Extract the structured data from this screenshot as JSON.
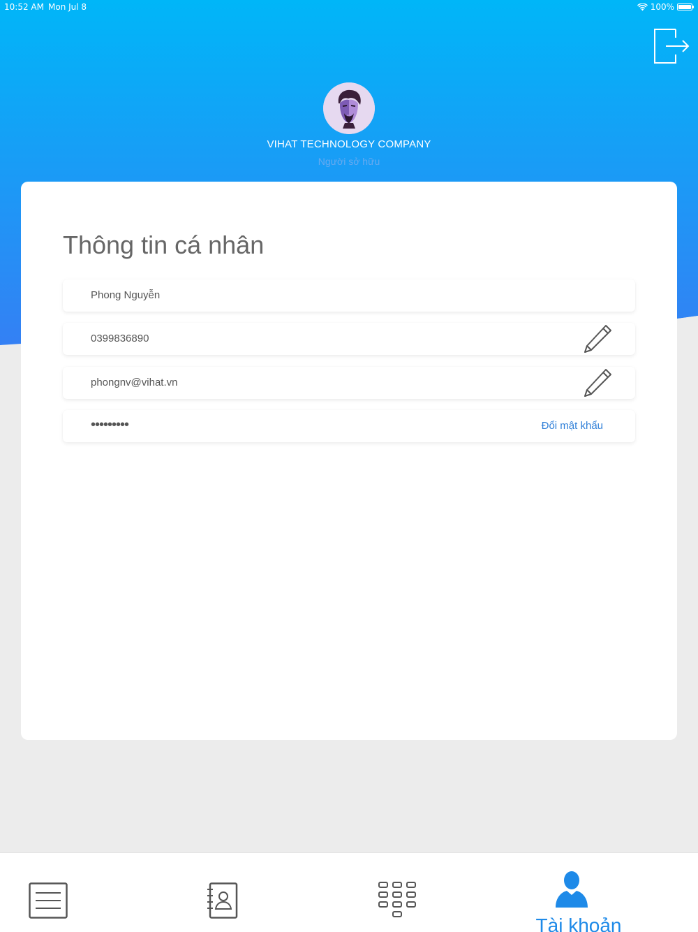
{
  "status_bar": {
    "time": "10:52 AM",
    "date": "Mon Jul 8",
    "battery": "100%",
    "icons": [
      "wifi-icon",
      "battery-icon"
    ]
  },
  "header": {
    "company_name": "VIHAT TECHNOLOGY COMPANY",
    "role": "Người sở hữu",
    "logout_icon": "logout-icon",
    "avatar_icon": "user-avatar"
  },
  "profile": {
    "title": "Thông tin cá nhân",
    "name": "Phong Nguyễn",
    "phone": "0399836890",
    "email": "phongnv@vihat.vn",
    "password_mask": "•••••••••",
    "change_password_label": "Đổi mật khẩu",
    "edit_icon": "pencil-icon"
  },
  "tabbar": {
    "tabs": [
      {
        "icon": "list-icon",
        "label": "",
        "active": false
      },
      {
        "icon": "contacts-book-icon",
        "label": "",
        "active": false
      },
      {
        "icon": "dialpad-icon",
        "label": "",
        "active": false
      },
      {
        "icon": "account-icon",
        "label": "Tài khoản",
        "active": true
      }
    ]
  },
  "colors": {
    "header_gradient_top": "#00b4f8",
    "header_gradient_bottom": "#2f85f5",
    "accent": "#1e8ae8",
    "inactive_icon": "#555555",
    "page_background": "#ececec"
  }
}
